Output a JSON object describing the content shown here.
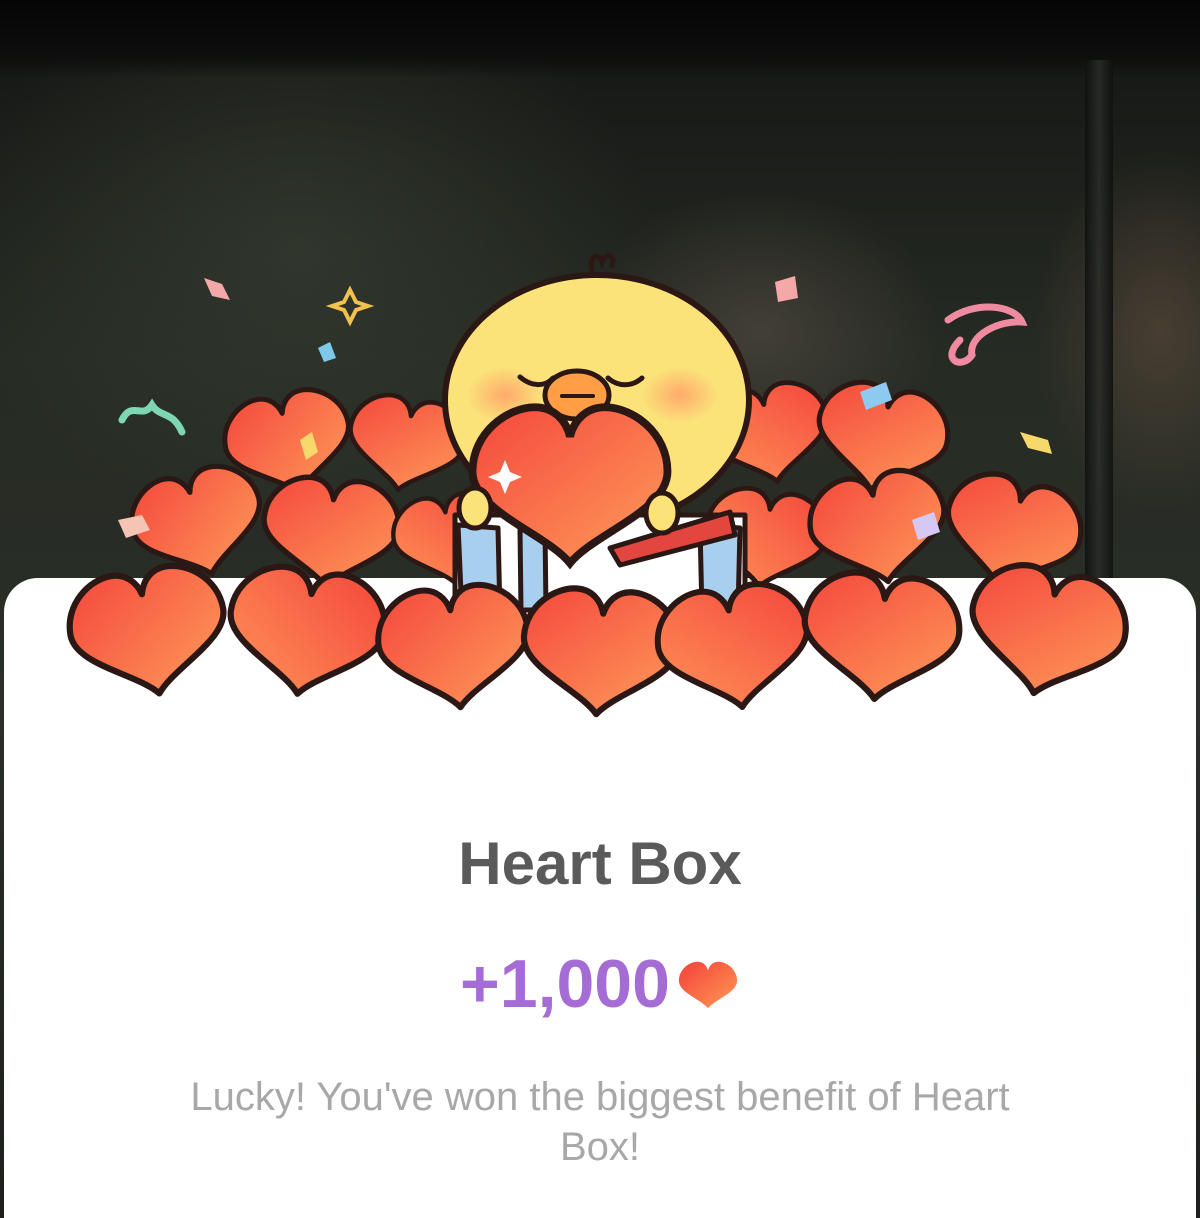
{
  "popup": {
    "title": "Heart Box",
    "reward_amount": "+1,000",
    "reward_icon": "heart-icon",
    "message": "Lucky! You've won the biggest benefit of Heart Box!"
  },
  "illustration": {
    "character": "chick-icon",
    "heart_color": "#f7623f",
    "heart_highlight": "#ff9a5a",
    "outline_color": "#2b1714",
    "chick_color": "#fbe37a"
  },
  "colors": {
    "title": "#5a5a5a",
    "reward": "#a66cd6",
    "message": "#a8a8a8",
    "card": "#ffffff"
  }
}
